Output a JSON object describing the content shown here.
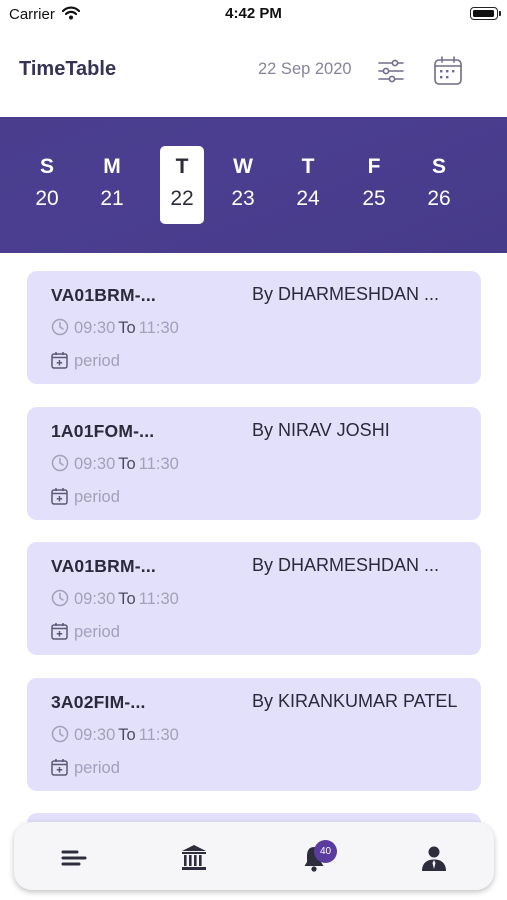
{
  "status_bar": {
    "carrier": "Carrier",
    "time": "4:42 PM"
  },
  "header": {
    "title": "TimeTable",
    "date": "22 Sep 2020"
  },
  "week": {
    "days": [
      {
        "weekday": "S",
        "date": "20"
      },
      {
        "weekday": "M",
        "date": "21"
      },
      {
        "weekday": "T",
        "date": "22"
      },
      {
        "weekday": "W",
        "date": "23"
      },
      {
        "weekday": "T",
        "date": "24"
      },
      {
        "weekday": "F",
        "date": "25"
      },
      {
        "weekday": "S",
        "date": "26"
      }
    ],
    "selected_index": 2
  },
  "sessions": [
    {
      "code": "VA01BRM-...",
      "by": "By DHARMESHDAN ...",
      "start": "09:30",
      "to": "To",
      "end": "11:30",
      "type": "period"
    },
    {
      "code": "1A01FOM-...",
      "by": "By NIRAV JOSHI",
      "start": "09:30",
      "to": "To",
      "end": "11:30",
      "type": "period"
    },
    {
      "code": "VA01BRM-...",
      "by": "By DHARMESHDAN ...",
      "start": "09:30",
      "to": "To",
      "end": "11:30",
      "type": "period"
    },
    {
      "code": "3A02FIM-...",
      "by": "By KIRANKUMAR PATEL",
      "start": "09:30",
      "to": "To",
      "end": "11:30",
      "type": "period"
    }
  ],
  "bottom_nav": {
    "items": [
      "menu-icon",
      "institution-icon",
      "bell-icon",
      "user-icon"
    ],
    "notification_count": "40"
  },
  "colors": {
    "primary": "#4a3d8e",
    "card": "#e2e0fa",
    "badge": "#5a3b9e"
  }
}
